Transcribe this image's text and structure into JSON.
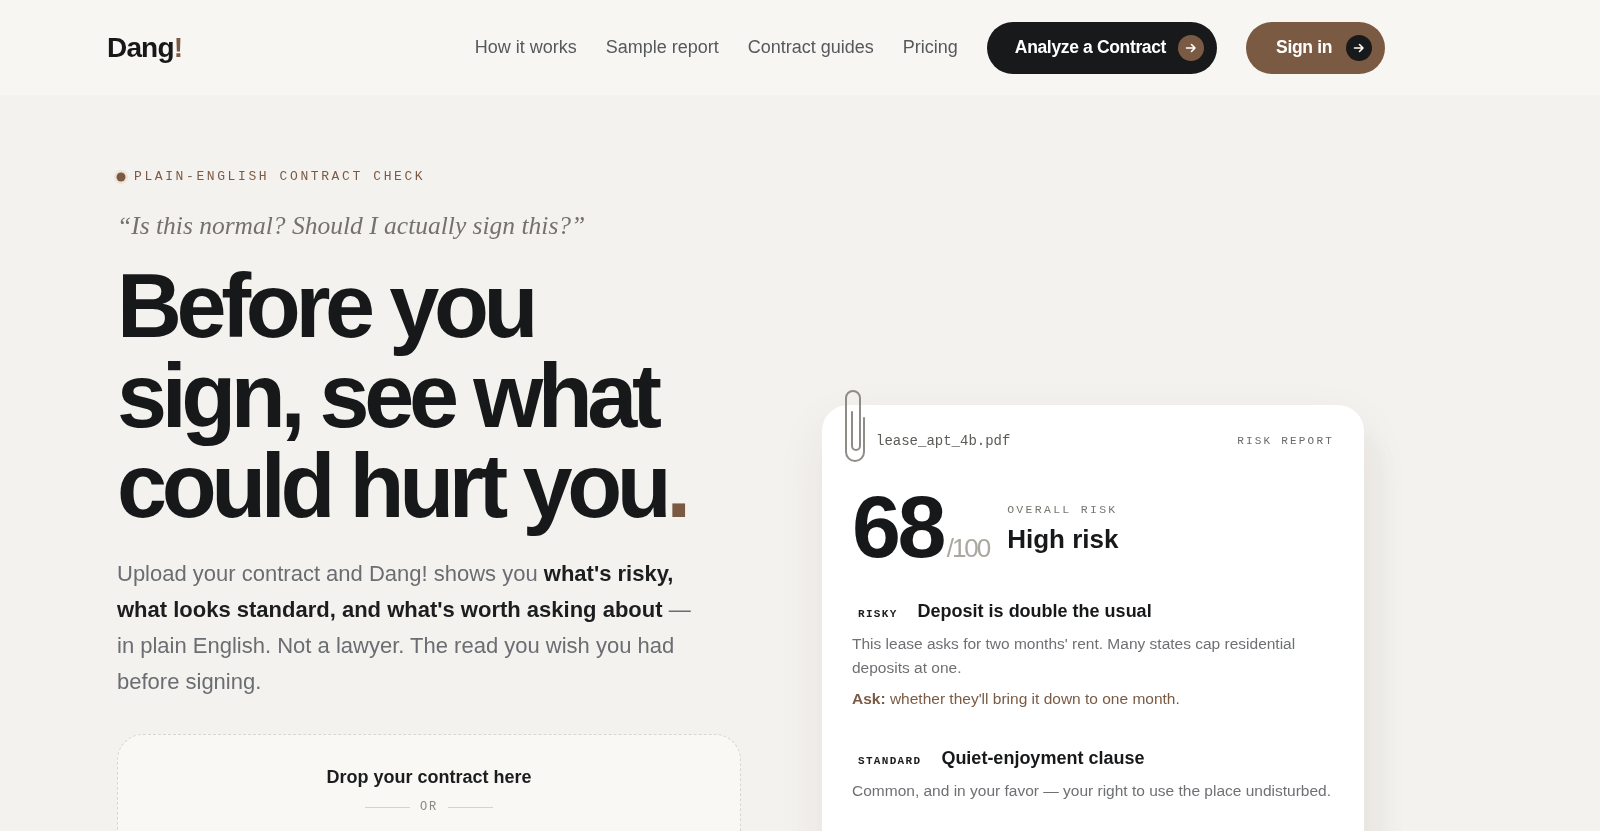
{
  "nav": {
    "logo": {
      "text": "Dang",
      "accent": "!"
    },
    "links": [
      "How it works",
      "Sample report",
      "Contract guides",
      "Pricing"
    ],
    "buttons": [
      {
        "label": "Analyze a Contract",
        "kind": "primary"
      },
      {
        "label": "Sign in",
        "kind": "secondary"
      }
    ]
  },
  "hero": {
    "eyebrow": "PLAIN-ENGLISH CONTRACT CHECK",
    "quote": "“Is this normal? Should I actually sign this?”",
    "headline": "Before you sign, see what could hurt you",
    "headline_accent": ".",
    "intro": "Upload your contract and Dang! shows you **what's risky, what looks standard, and what's worth asking about** — in plain English. Not a lawyer. The read you wish you had before signing.",
    "drop_zone": {
      "title": "Drop your contract here",
      "divider": "OR"
    }
  },
  "report": {
    "filename": "lease_apt_4b.pdf",
    "label": "RISK REPORT",
    "score": "68",
    "score_max": "/100",
    "score_label": "OVERALL RISK",
    "verdict": "High risk",
    "findings": [
      {
        "tag": "RISKY",
        "title": "Deposit is double the usual",
        "description": "This lease asks for two months' rent. Many states cap residential deposits at one.",
        "ask": "**Ask:** whether they'll bring it down to one month."
      },
      {
        "tag": "STANDARD",
        "title": "Quiet-enjoyment clause",
        "description": "Common, and in your favor — your right to use the place undisturbed."
      }
    ]
  }
}
